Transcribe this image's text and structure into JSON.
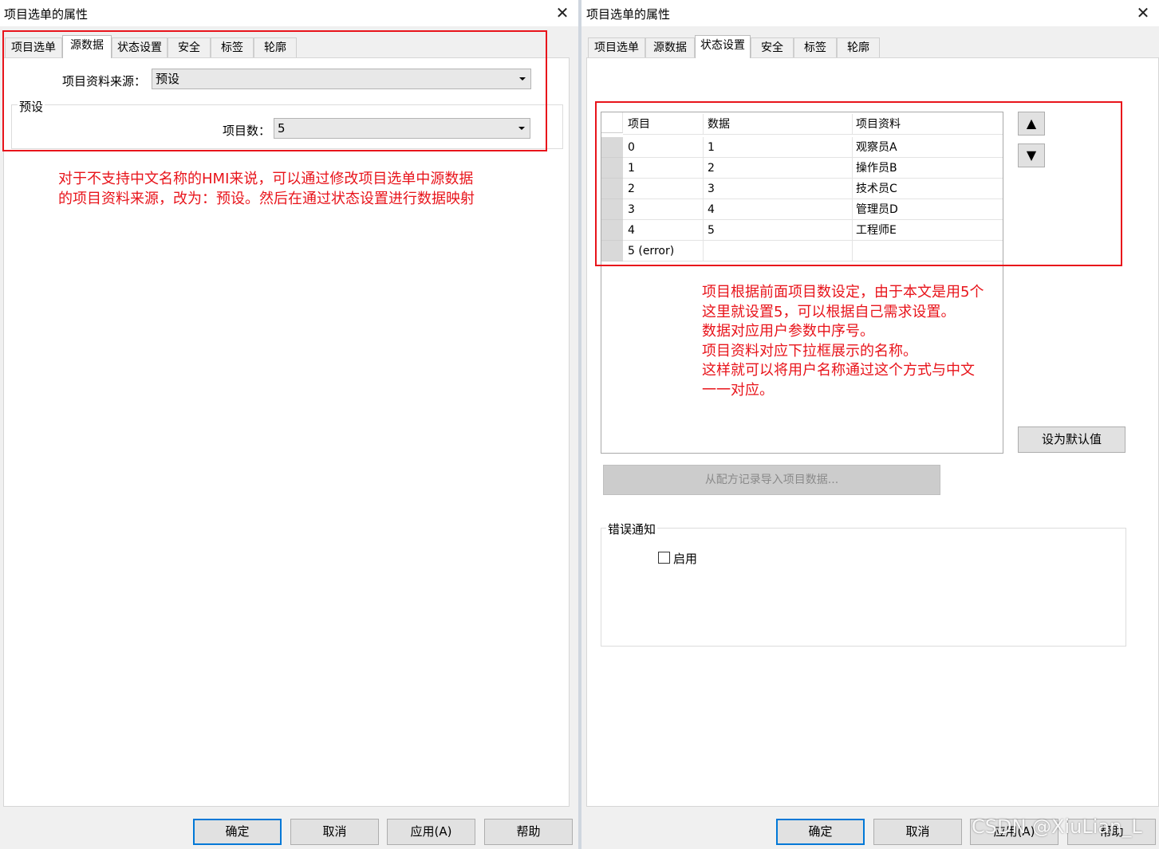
{
  "left_dialog": {
    "title": "项目选单的属性",
    "tabs": [
      "项目选单",
      "源数据",
      "状态设置",
      "安全",
      "标签",
      "轮廓"
    ],
    "active_tab": "源数据",
    "source_label": "项目资料来源：",
    "source_value": "预设",
    "group_title": "预设",
    "count_label": "项目数：",
    "count_value": "5",
    "annotation": [
      "对于不支持中文名称的HMI来说，可以通过修改项目选单中源数据",
      "的项目资料来源，改为：预设。然后在通过状态设置进行数据映射"
    ],
    "buttons": {
      "ok": "确定",
      "cancel": "取消",
      "apply": "应用(A)",
      "help": "帮助"
    }
  },
  "right_dialog": {
    "title": "项目选单的属性",
    "tabs": [
      "项目选单",
      "源数据",
      "状态设置",
      "安全",
      "标签",
      "轮廓"
    ],
    "active_tab": "状态设置",
    "table": {
      "headers": [
        "项目",
        "数据",
        "项目资料"
      ],
      "rows": [
        [
          "0",
          "1",
          "观察员A"
        ],
        [
          "1",
          "2",
          "操作员B"
        ],
        [
          "2",
          "3",
          "技术员C"
        ],
        [
          "3",
          "4",
          "管理员D"
        ],
        [
          "4",
          "5",
          "工程师E"
        ],
        [
          "5 (error)",
          "",
          ""
        ]
      ]
    },
    "move_up_icon": "▲",
    "move_down_icon": "▼",
    "set_default_label": "设为默认值",
    "import_label": "从配方记录导入项目数据...",
    "error_group_title": "错误通知",
    "enable_label": "启用",
    "enable_checked": false,
    "annotation": [
      "项目根据前面项目数设定，由于本文是用5个",
      "这里就设置5，可以根据自己需求设置。",
      "数据对应用户参数中序号。",
      "项目资料对应下拉框展示的名称。",
      "这样就可以将用户名称通过这个方式与中文",
      "一一对应。"
    ],
    "buttons": {
      "ok": "确定",
      "cancel": "取消",
      "apply": "应用(A)",
      "help": "帮助"
    }
  },
  "watermark": "CSDN @XiuLian_L",
  "colors": {
    "annotation": "#e8141b",
    "default_button_border": "#0078d7",
    "dialog_bg": "#f0f0f0"
  },
  "icons": {
    "close": "close-icon",
    "dropdown": "chevron-down-icon"
  }
}
